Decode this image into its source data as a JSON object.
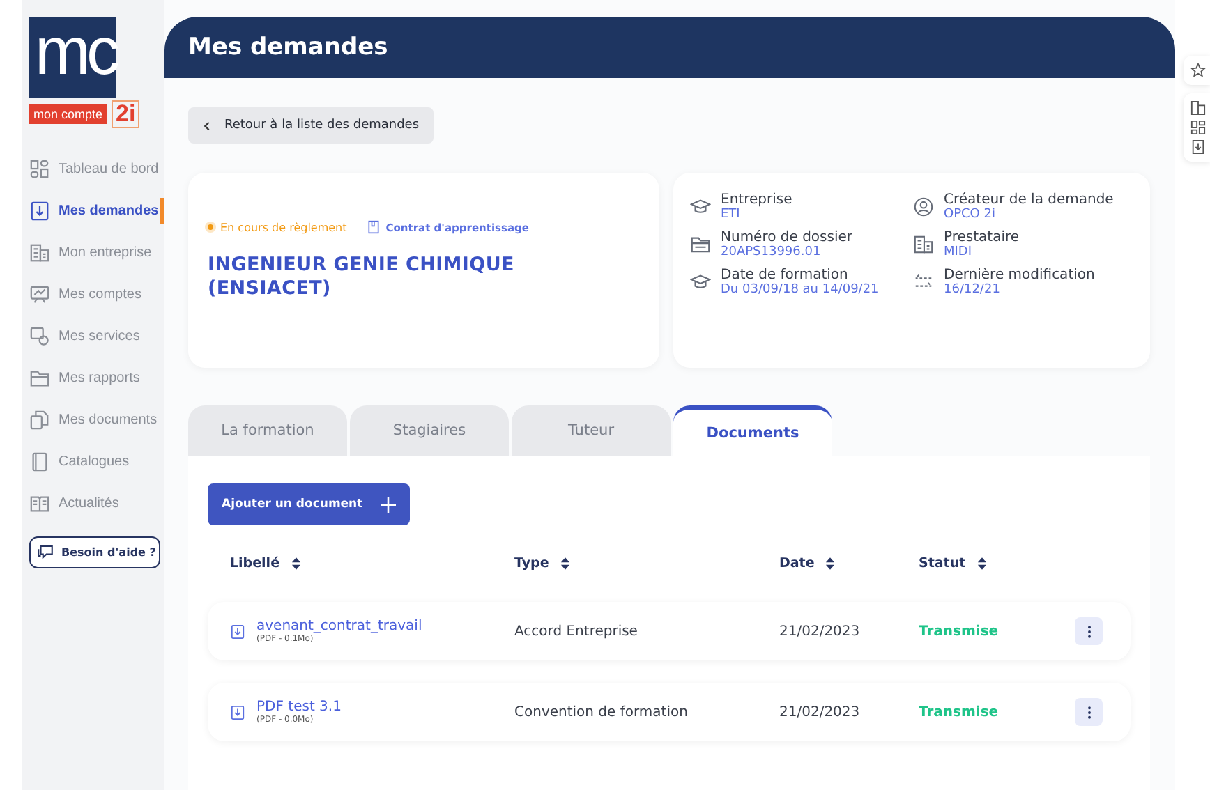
{
  "logo": {
    "letters": "mc",
    "caption": "mon compte",
    "suffix": "2i"
  },
  "sidebar": {
    "items": [
      {
        "label": "Tableau de bord",
        "selected": false
      },
      {
        "label": "Mes demandes",
        "selected": true
      },
      {
        "label": "Mon entreprise",
        "selected": false
      },
      {
        "label": "Mes comptes",
        "selected": false
      },
      {
        "label": "Mes services",
        "selected": false
      },
      {
        "label": "Mes rapports",
        "selected": false
      },
      {
        "label": "Mes documents",
        "selected": false
      },
      {
        "label": "Catalogues",
        "selected": false
      },
      {
        "label": "Actualités",
        "selected": false
      }
    ],
    "help": "Besoin d'aide ?"
  },
  "header": {
    "title": "Mes demandes"
  },
  "back_button": "Retour à la liste des demandes",
  "summary": {
    "status": "En cours de règlement",
    "contract": "Contrat d'apprentissage",
    "title": "INGENIEUR GENIE CHIMIQUE (ENSIACET)"
  },
  "details": [
    {
      "label": "Entreprise",
      "value": "ETI"
    },
    {
      "label": "Créateur de la demande",
      "value": "OPCO 2i"
    },
    {
      "label": "Numéro de dossier",
      "value": "20APS13996.01"
    },
    {
      "label": "Prestataire",
      "value": "MIDI"
    },
    {
      "label": "Date de formation",
      "value": "Du 03/09/18 au 14/09/21"
    },
    {
      "label": "Dernière modification",
      "value": "16/12/21"
    }
  ],
  "tabs": [
    {
      "label": "La formation",
      "selected": false
    },
    {
      "label": "Stagiaires",
      "selected": false
    },
    {
      "label": "Tuteur",
      "selected": false
    },
    {
      "label": "Documents",
      "selected": true
    }
  ],
  "add_button": "Ajouter un document",
  "table": {
    "columns": [
      "Libellé",
      "Type",
      "Date",
      "Statut"
    ],
    "rows": [
      {
        "name": "avenant_contrat_travail",
        "meta": "(PDF - 0.1Mo)",
        "type": "Accord Entreprise",
        "date": "21/02/2023",
        "status": "Transmise"
      },
      {
        "name": "PDF test 3.1",
        "meta": "(PDF - 0.0Mo)",
        "type": "Convention de formation",
        "date": "21/02/2023",
        "status": "Transmise"
      }
    ]
  }
}
